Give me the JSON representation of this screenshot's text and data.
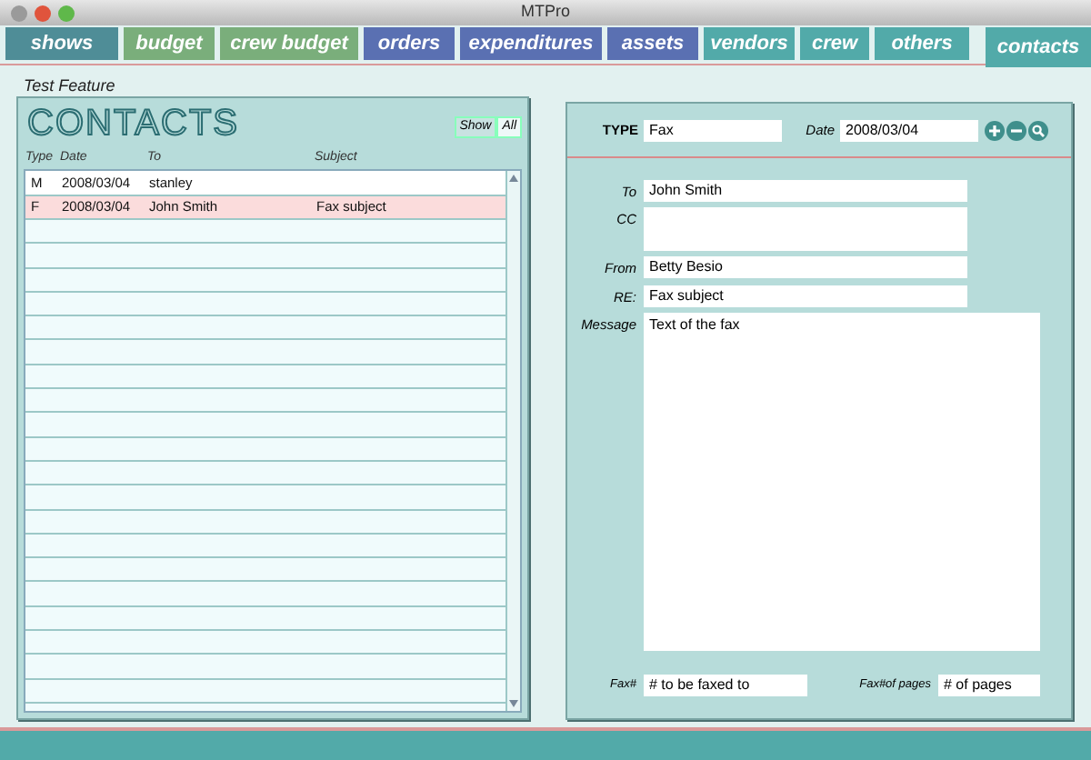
{
  "window": {
    "title": "MTPro"
  },
  "tabs": [
    {
      "label": "shows",
      "color": "#4f8d97",
      "selected": false
    },
    {
      "label": "budget",
      "color": "#7aae7b",
      "selected": false
    },
    {
      "label": "crew budget",
      "color": "#7aae7b",
      "selected": false
    },
    {
      "label": "orders",
      "color": "#5a70b2",
      "selected": false
    },
    {
      "label": "expenditures",
      "color": "#5a70b2",
      "selected": false
    },
    {
      "label": "assets",
      "color": "#5a70b2",
      "selected": false
    },
    {
      "label": "vendors",
      "color": "#52aaa9",
      "selected": false
    },
    {
      "label": "crew",
      "color": "#52aaa9",
      "selected": false
    },
    {
      "label": "others",
      "color": "#52aaa9",
      "selected": false
    },
    {
      "label": "contacts",
      "color": "#52aaa9",
      "selected": true
    }
  ],
  "section_title": "Test Feature",
  "list_panel": {
    "title": "CONTACTS",
    "filters": [
      {
        "label": "Show",
        "selected": false
      },
      {
        "label": "All",
        "selected": true
      }
    ],
    "columns": [
      "Type",
      "Date",
      "To",
      "Subject"
    ],
    "rows": [
      {
        "cells": [
          "M",
          "2008/03/04",
          "stanley",
          ""
        ],
        "selected": false
      },
      {
        "cells": [
          "F",
          "2008/03/04",
          "John Smith",
          "Fax subject"
        ],
        "selected": true
      }
    ]
  },
  "detail": {
    "type_label": "TYPE",
    "type_value": "Fax",
    "date_label": "Date",
    "date_value": "2008/03/04",
    "fields": [
      {
        "label": "To",
        "value": "John Smith",
        "kind": "line"
      },
      {
        "label": "CC",
        "kind": "box"
      },
      {
        "label": "From",
        "value": "Betty Besio",
        "kind": "line"
      },
      {
        "label": "RE:",
        "value": "Fax subject",
        "kind": "line"
      },
      {
        "label": "Message",
        "value": "Text of the fax",
        "kind": "area"
      }
    ],
    "fax_label": "Fax#",
    "fax_value": "# to be faxed to",
    "pages_label": "Fax#of pages",
    "pages_value": "# of pages"
  }
}
